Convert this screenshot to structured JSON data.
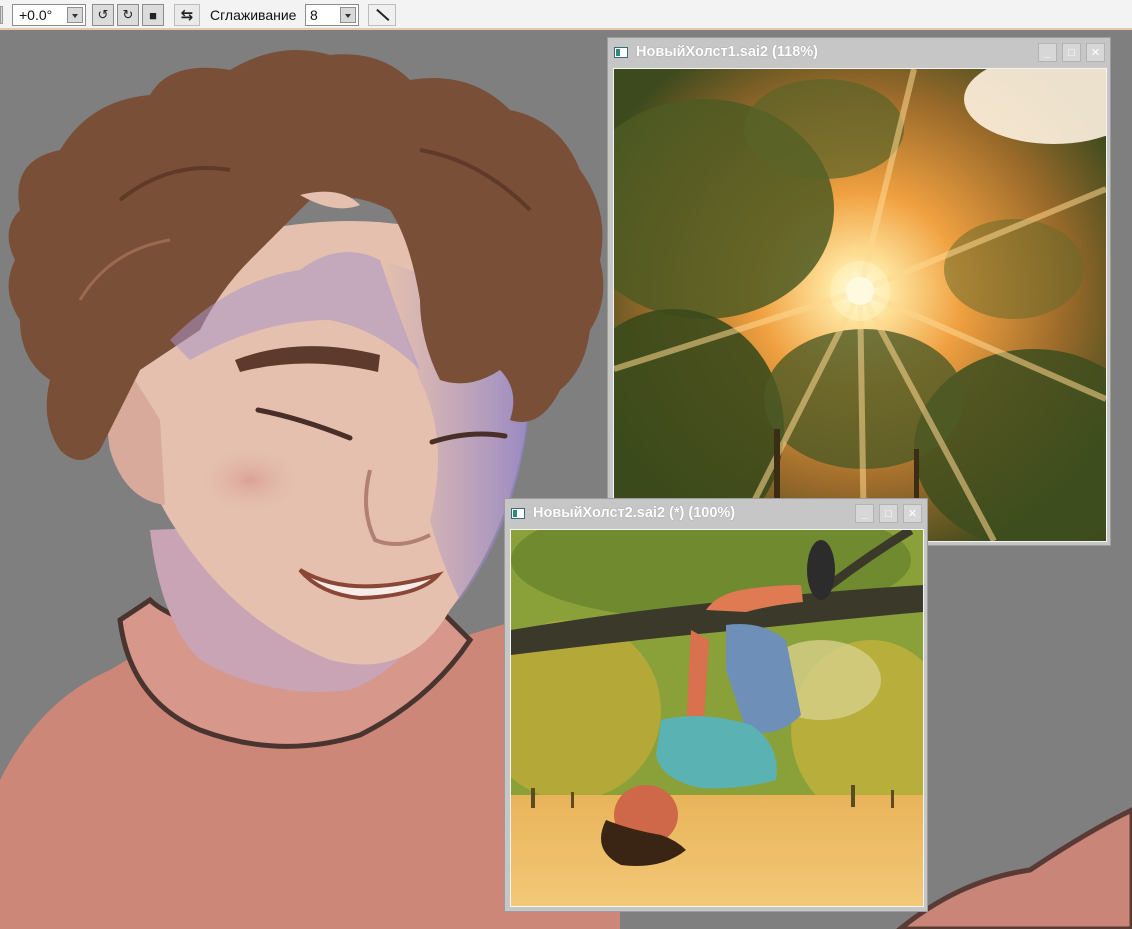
{
  "toolbar": {
    "angle_value": "+0.0°",
    "rotate_ccw_icon": "↺",
    "rotate_cw_icon": "↻",
    "reset_icon": "■",
    "flip_icon": "⇆",
    "smoothing_label": "Сглаживание",
    "smoothing_value": "8"
  },
  "windows": [
    {
      "title": "НовыйХолст1.sai2 (118%)",
      "minimize": "_",
      "maximize": "□",
      "close": "✕"
    },
    {
      "title": "НовыйХолст2.sai2 (*) (100%)",
      "minimize": "_",
      "maximize": "□",
      "close": "✕"
    }
  ],
  "colors": {
    "workspace": "#7f7f7f",
    "titlebar": "#c6c6c6",
    "skin": "#e5c0ae",
    "hair": "#7a4f38",
    "sweater": "#cc8778"
  }
}
